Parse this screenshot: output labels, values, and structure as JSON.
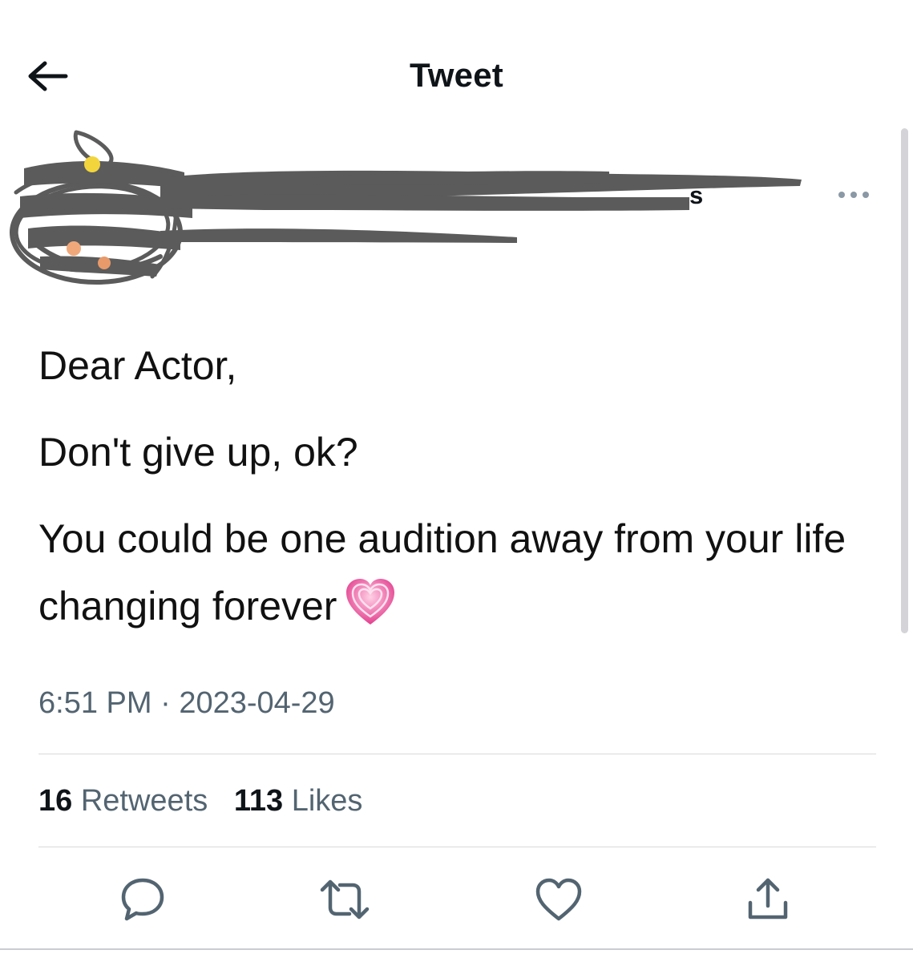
{
  "header": {
    "title": "Tweet",
    "back_icon": "arrow-left-icon"
  },
  "author": {
    "display_name_visible_fragment": "s",
    "more_icon": "more-horizontal-icon"
  },
  "tweet": {
    "lines": [
      "Dear Actor,",
      "Don't give up, ok?",
      "You could be one audition away from your life changing forever"
    ],
    "emoji": "growing-heart-emoji"
  },
  "meta": {
    "time": "6:51 PM",
    "separator": "·",
    "date": "2023-04-29"
  },
  "stats": {
    "retweets_count": "16",
    "retweets_label": "Retweets",
    "likes_count": "113",
    "likes_label": "Likes"
  },
  "actions": {
    "reply_icon": "reply-icon",
    "retweet_icon": "retweet-icon",
    "like_icon": "heart-icon",
    "share_icon": "share-icon"
  },
  "colors": {
    "text": "#0f1419",
    "secondary": "#536471",
    "scribble": "#5b5b5b",
    "heart_pink": "#e64a97"
  }
}
